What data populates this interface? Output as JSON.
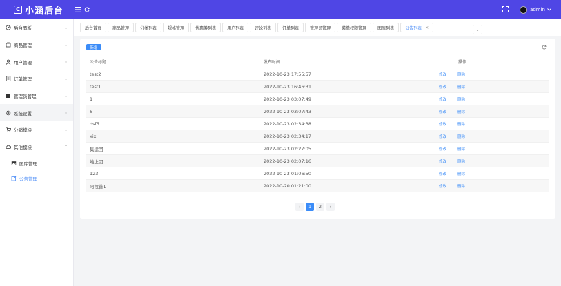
{
  "app": {
    "logo_letter": "C",
    "title": "小涵后台"
  },
  "header": {
    "user": "admin"
  },
  "sidebar": {
    "items": [
      {
        "label": "后台面板",
        "icon": "dashboard-icon"
      },
      {
        "label": "商品管理",
        "icon": "goods-icon"
      },
      {
        "label": "用户管理",
        "icon": "user-icon"
      },
      {
        "label": "订单管理",
        "icon": "order-icon"
      },
      {
        "label": "管理员管理",
        "icon": "admin-icon"
      },
      {
        "label": "系统设置",
        "icon": "settings-icon"
      },
      {
        "label": "分销模块",
        "icon": "cart-icon"
      },
      {
        "label": "其他模块",
        "icon": "cloud-icon"
      }
    ],
    "subitems": [
      {
        "label": "图库管理",
        "icon": "picture-icon"
      },
      {
        "label": "公告管理",
        "icon": "notice-icon"
      }
    ]
  },
  "tabs": [
    "后台首页",
    "商品管理",
    "分类列表",
    "规格管理",
    "优惠券列表",
    "用户列表",
    "评论列表",
    "订单列表",
    "管理员管理",
    "菜单权限管理",
    "图库列表",
    "公告列表"
  ],
  "toolbar": {
    "new_label": "新增"
  },
  "table": {
    "headers": [
      "公告标题",
      "发布时间",
      "操作"
    ],
    "edit_label": "修改",
    "delete_label": "删除",
    "rows": [
      {
        "title": "test2",
        "time": "2022-10-23 17:55:57"
      },
      {
        "title": "test1",
        "time": "2022-10-23 16:46:31"
      },
      {
        "title": "1",
        "time": "2022-10-23 03:07:49"
      },
      {
        "title": "6",
        "time": "2022-10-23 03:07:43"
      },
      {
        "title": "dsf5",
        "time": "2022-10-23 02:34:38"
      },
      {
        "title": "xixi",
        "time": "2022-10-23 02:34:17"
      },
      {
        "title": "集运团",
        "time": "2022-10-23 02:27:05"
      },
      {
        "title": "地上团",
        "time": "2022-10-23 02:07:16"
      },
      {
        "title": "123",
        "time": "2022-10-23 01:06:50"
      },
      {
        "title": "阿拉善1",
        "time": "2022-10-20 01:21:00"
      }
    ]
  },
  "pagination": {
    "pages": [
      "1",
      "2"
    ],
    "current": "1",
    "prev": "‹",
    "next": "›"
  },
  "colors": {
    "header": "#4f46e5",
    "accent": "#3b8cf8"
  }
}
